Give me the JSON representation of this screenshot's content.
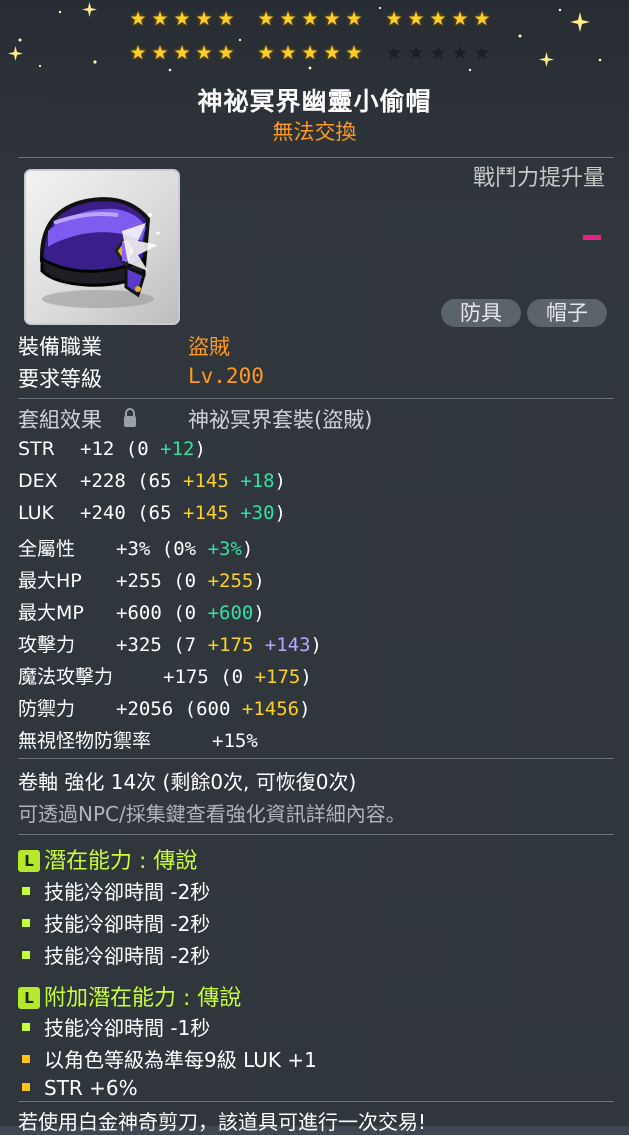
{
  "stars": {
    "row1": [
      true,
      true,
      true,
      true,
      true,
      true,
      true,
      true,
      true,
      true,
      true,
      true,
      true,
      true,
      true
    ],
    "row2": [
      true,
      true,
      true,
      true,
      true,
      true,
      true,
      true,
      true,
      true,
      false,
      false,
      false,
      false,
      false
    ]
  },
  "item": {
    "name": "神祕冥界幽靈小偷帽",
    "trade": "無法交換",
    "power_label": "戰鬥力提升量",
    "tags": [
      "防具",
      "帽子"
    ]
  },
  "requirements": {
    "job_label": "裝備職業",
    "job_value": "盜賊",
    "level_label": "要求等級",
    "level_value": "Lv.200"
  },
  "set": {
    "label": "套組效果",
    "name": "神祕冥界套裝(盜賊)"
  },
  "stats": [
    {
      "name": "STR",
      "total": "+12",
      "base": "0",
      "b1": "",
      "b2": "+12"
    },
    {
      "name": "DEX",
      "total": "+228",
      "base": "65",
      "b1": "+145",
      "b2": "+18"
    },
    {
      "name": "LUK",
      "total": "+240",
      "base": "65",
      "b1": "+145",
      "b2": "+30"
    },
    {
      "name": "全屬性",
      "total": "+3%",
      "base": "0%",
      "b1": "",
      "b2": "+3%"
    },
    {
      "name": "最大HP",
      "total": "+255",
      "base": "0",
      "b1": "+255",
      "b2": ""
    },
    {
      "name": "最大MP",
      "total": "+600",
      "base": "0",
      "b1": "",
      "b2": "+600"
    },
    {
      "name": "攻擊力",
      "total": "+325",
      "base": "7",
      "b1": "+175",
      "b2": "+143"
    },
    {
      "name": "魔法攻擊力",
      "total": "+175",
      "base": "0",
      "b1": "+175",
      "b2": ""
    },
    {
      "name": "防禦力",
      "total": "+2056",
      "base": "600",
      "b1": "+1456",
      "b2": ""
    },
    {
      "name": "無視怪物防禦率",
      "total": "+15%",
      "base": "",
      "b1": "",
      "b2": ""
    }
  ],
  "scroll": {
    "text": "卷軸 強化 14次 (剩餘0次, 可恢復0次)",
    "note": "可透過NPC/採集鍵查看強化資訊詳細內容。"
  },
  "potential": {
    "badge": "L",
    "title": "潛在能力 : 傳說",
    "lines": [
      "技能冷卻時間 -2秒",
      "技能冷卻時間 -2秒",
      "技能冷卻時間 -2秒"
    ]
  },
  "bonus_potential": {
    "badge": "L",
    "title": "附加潛在能力 : 傳說",
    "lines": [
      "技能冷卻時間 -1秒",
      "以角色等級為準每9級 LUK +1",
      "STR +6%"
    ]
  },
  "footer": {
    "text": "若使用白金神奇剪刀，該道具可進行一次交易!"
  },
  "colors": {
    "star_on": "#ffcf26",
    "trade": "#ff9a1f",
    "potential": "#c8ff3a",
    "bonus_yellow": "#ffd21f",
    "bonus_green": "#35e0a4",
    "bonus_purple": "#b7a8ff",
    "power_dash": "#e5267e"
  }
}
